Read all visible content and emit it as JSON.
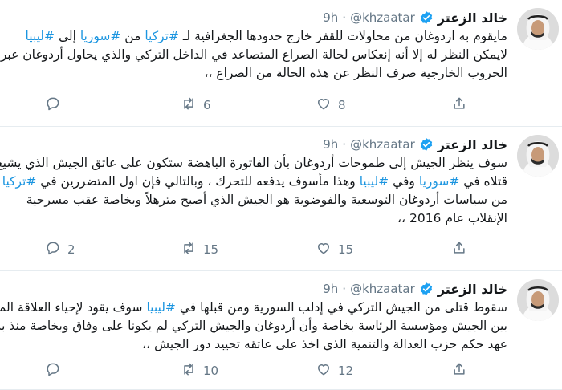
{
  "tweets": [
    {
      "author": "خالد الزعتر",
      "handle": "@khzaatar",
      "time": "9h",
      "lines": [
        [
          {
            "t": "مايقوم به اردوغان من محاولات للقفز خارج حدودها الجغرافية لـ "
          },
          {
            "t": "#تركيا",
            "h": true
          },
          {
            "t": " من "
          },
          {
            "t": "#سوريا",
            "h": true
          },
          {
            "t": " إلى "
          },
          {
            "t": "#ليبيا",
            "h": true
          }
        ],
        [
          {
            "t": "لايمكن النظر له إلا أنه إنعكاس لحالة الصراع المتصاعد في الداخل التركي والذي يحاول أردوغان عبر"
          }
        ],
        [
          {
            "t": "الحروب الخارجية صرف النظر عن هذه الحالة من الصراع ،،"
          }
        ]
      ],
      "replies": "",
      "retweets": "6",
      "likes": "8"
    },
    {
      "author": "خالد الزعتر",
      "handle": "@khzaatar",
      "time": "9h",
      "lines": [
        [
          {
            "t": "سوف ينظر الجيش إلى طموحات أردوغان بأن الفاتورة الباهضة ستكون على عاتق الجيش الذي يشيع"
          }
        ],
        [
          {
            "t": "قتلاه في "
          },
          {
            "t": "#سوريا",
            "h": true
          },
          {
            "t": " وفي "
          },
          {
            "t": "#ليبيا",
            "h": true
          },
          {
            "t": " وهذا مأسوف يدفعه للتحرك ، وبالتالي فإن اول المتضررين في "
          },
          {
            "t": "#تركيا",
            "h": true
          }
        ],
        [
          {
            "t": "من سياسات أردوغان التوسعية والفوضوية هو الجيش الذي أصبح مترهلاً وبخاصة عقب مسرحية"
          }
        ],
        [
          {
            "t": "الإنقلاب عام 2016 ،،"
          }
        ]
      ],
      "replies": "2",
      "retweets": "15",
      "likes": "15"
    },
    {
      "author": "خالد الزعتر",
      "handle": "@khzaatar",
      "time": "9h",
      "lines": [
        [
          {
            "t": "سقوط قتلى من الجيش التركي في إدلب السورية ومن قبلها في "
          },
          {
            "t": "#ليبيا",
            "h": true
          },
          {
            "t": " سوف يقود لإحياء العلاقة المتوترة"
          }
        ],
        [
          {
            "t": "بين الجيش ومؤسسة الرئاسة بخاصة وأن أردوغان والجيش التركي لم يكونا على وفاق وبخاصة منذ بداية"
          }
        ],
        [
          {
            "t": "عهد حكم حزب العدالة والتنمية الذي اخذ على عاتقه تحييد دور الجيش ،،"
          }
        ]
      ],
      "replies": "",
      "retweets": "10",
      "likes": "12"
    }
  ],
  "icons": {
    "reply": "reply-icon",
    "retweet": "retweet-icon",
    "like": "heart-icon",
    "more": "more-icon",
    "verified": "verified-badge-icon"
  },
  "colors": {
    "hashtag": "#1b95e0",
    "verified": "#1da1f2",
    "muted": "#657786"
  }
}
